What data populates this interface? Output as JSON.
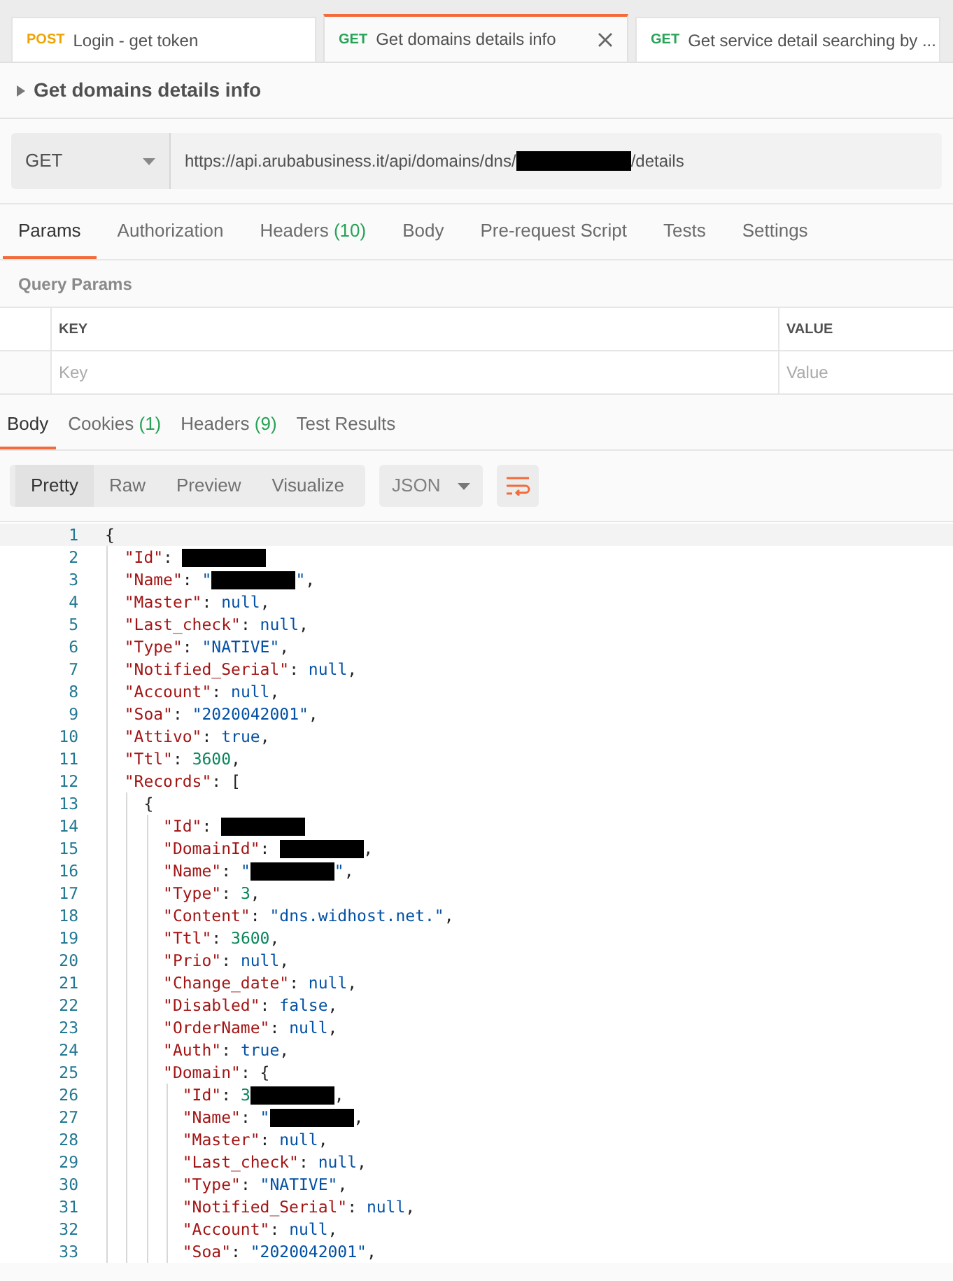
{
  "tabs": [
    {
      "method": "POST",
      "color": "#f0a300",
      "label": "Login - get token",
      "selected": false
    },
    {
      "method": "GET",
      "color": "#26a356",
      "label": "Get domains details info",
      "selected": true
    },
    {
      "method": "GET",
      "color": "#26a356",
      "label": "Get service detail searching by ...",
      "selected": false
    }
  ],
  "request_title": "Get domains details info",
  "request": {
    "method": "GET",
    "url_before": "https://api.arubabusiness.it/api/domains/dns/",
    "url_after": "/details"
  },
  "request_tabs": [
    {
      "label": "Params",
      "selected": true
    },
    {
      "label": "Authorization",
      "selected": false
    },
    {
      "label": "Headers",
      "count": "(10)",
      "selected": false
    },
    {
      "label": "Body",
      "selected": false
    },
    {
      "label": "Pre-request Script",
      "selected": false
    },
    {
      "label": "Tests",
      "selected": false
    },
    {
      "label": "Settings",
      "selected": false
    }
  ],
  "query_params": {
    "title": "Query Params",
    "columns": [
      "KEY",
      "VALUE"
    ],
    "placeholders": [
      "Key",
      "Value"
    ]
  },
  "response_tabs": [
    {
      "label": "Body",
      "selected": true
    },
    {
      "label": "Cookies",
      "count": "(1)",
      "selected": false
    },
    {
      "label": "Headers",
      "count": "(9)",
      "selected": false
    },
    {
      "label": "Test Results",
      "selected": false
    }
  ],
  "view_modes": [
    {
      "label": "Pretty",
      "selected": true
    },
    {
      "label": "Raw",
      "selected": false
    },
    {
      "label": "Preview",
      "selected": false
    },
    {
      "label": "Visualize",
      "selected": false
    }
  ],
  "format": "JSON",
  "code_lines": [
    {
      "number": "1",
      "tokens": [
        {
          "kind": "punct",
          "text": "{"
        }
      ]
    },
    {
      "number": "2",
      "tokens": [
        {
          "kind": "key",
          "text": "  \"Id\""
        },
        {
          "kind": "punct",
          "text": ": "
        },
        {
          "kind": "redacted"
        }
      ]
    },
    {
      "number": "3",
      "tokens": [
        {
          "kind": "key",
          "text": "  \"Name\""
        },
        {
          "kind": "punct",
          "text": ": "
        },
        {
          "kind": "string",
          "text": "\""
        },
        {
          "kind": "redacted"
        },
        {
          "kind": "string",
          "text": "\""
        },
        {
          "kind": "punct",
          "text": ","
        }
      ]
    },
    {
      "number": "4",
      "tokens": [
        {
          "kind": "key",
          "text": "  \"Master\""
        },
        {
          "kind": "punct",
          "text": ": "
        },
        {
          "kind": "literal",
          "text": "null"
        },
        {
          "kind": "punct",
          "text": ","
        }
      ]
    },
    {
      "number": "5",
      "tokens": [
        {
          "kind": "key",
          "text": "  \"Last_check\""
        },
        {
          "kind": "punct",
          "text": ": "
        },
        {
          "kind": "literal",
          "text": "null"
        },
        {
          "kind": "punct",
          "text": ","
        }
      ]
    },
    {
      "number": "6",
      "tokens": [
        {
          "kind": "key",
          "text": "  \"Type\""
        },
        {
          "kind": "punct",
          "text": ": "
        },
        {
          "kind": "string",
          "text": "\"NATIVE\""
        },
        {
          "kind": "punct",
          "text": ","
        }
      ]
    },
    {
      "number": "7",
      "tokens": [
        {
          "kind": "key",
          "text": "  \"Notified_Serial\""
        },
        {
          "kind": "punct",
          "text": ": "
        },
        {
          "kind": "literal",
          "text": "null"
        },
        {
          "kind": "punct",
          "text": ","
        }
      ]
    },
    {
      "number": "8",
      "tokens": [
        {
          "kind": "key",
          "text": "  \"Account\""
        },
        {
          "kind": "punct",
          "text": ": "
        },
        {
          "kind": "literal",
          "text": "null"
        },
        {
          "kind": "punct",
          "text": ","
        }
      ]
    },
    {
      "number": "9",
      "tokens": [
        {
          "kind": "key",
          "text": "  \"Soa\""
        },
        {
          "kind": "punct",
          "text": ": "
        },
        {
          "kind": "string",
          "text": "\"2020042001\""
        },
        {
          "kind": "punct",
          "text": ","
        }
      ]
    },
    {
      "number": "10",
      "tokens": [
        {
          "kind": "key",
          "text": "  \"Attivo\""
        },
        {
          "kind": "punct",
          "text": ": "
        },
        {
          "kind": "literal",
          "text": "true"
        },
        {
          "kind": "punct",
          "text": ","
        }
      ]
    },
    {
      "number": "11",
      "tokens": [
        {
          "kind": "key",
          "text": "  \"Ttl\""
        },
        {
          "kind": "punct",
          "text": ": "
        },
        {
          "kind": "number",
          "text": "3600"
        },
        {
          "kind": "punct",
          "text": ","
        }
      ]
    },
    {
      "number": "12",
      "tokens": [
        {
          "kind": "key",
          "text": "  \"Records\""
        },
        {
          "kind": "punct",
          "text": ": ["
        }
      ]
    },
    {
      "number": "13",
      "tokens": [
        {
          "kind": "punct",
          "text": "    {"
        }
      ]
    },
    {
      "number": "14",
      "tokens": [
        {
          "kind": "key",
          "text": "      \"Id\""
        },
        {
          "kind": "punct",
          "text": ": "
        },
        {
          "kind": "redacted"
        }
      ]
    },
    {
      "number": "15",
      "tokens": [
        {
          "kind": "key",
          "text": "      \"DomainId\""
        },
        {
          "kind": "punct",
          "text": ": "
        },
        {
          "kind": "redacted"
        },
        {
          "kind": "punct",
          "text": ","
        }
      ]
    },
    {
      "number": "16",
      "tokens": [
        {
          "kind": "key",
          "text": "      \"Name\""
        },
        {
          "kind": "punct",
          "text": ": "
        },
        {
          "kind": "string",
          "text": "\""
        },
        {
          "kind": "redacted"
        },
        {
          "kind": "string",
          "text": "\""
        },
        {
          "kind": "punct",
          "text": ","
        }
      ]
    },
    {
      "number": "17",
      "tokens": [
        {
          "kind": "key",
          "text": "      \"Type\""
        },
        {
          "kind": "punct",
          "text": ": "
        },
        {
          "kind": "number",
          "text": "3"
        },
        {
          "kind": "punct",
          "text": ","
        }
      ]
    },
    {
      "number": "18",
      "tokens": [
        {
          "kind": "key",
          "text": "      \"Content\""
        },
        {
          "kind": "punct",
          "text": ": "
        },
        {
          "kind": "string",
          "text": "\"dns.widhost.net.\""
        },
        {
          "kind": "punct",
          "text": ","
        }
      ]
    },
    {
      "number": "19",
      "tokens": [
        {
          "kind": "key",
          "text": "      \"Ttl\""
        },
        {
          "kind": "punct",
          "text": ": "
        },
        {
          "kind": "number",
          "text": "3600"
        },
        {
          "kind": "punct",
          "text": ","
        }
      ]
    },
    {
      "number": "20",
      "tokens": [
        {
          "kind": "key",
          "text": "      \"Prio\""
        },
        {
          "kind": "punct",
          "text": ": "
        },
        {
          "kind": "literal",
          "text": "null"
        },
        {
          "kind": "punct",
          "text": ","
        }
      ]
    },
    {
      "number": "21",
      "tokens": [
        {
          "kind": "key",
          "text": "      \"Change_date\""
        },
        {
          "kind": "punct",
          "text": ": "
        },
        {
          "kind": "literal",
          "text": "null"
        },
        {
          "kind": "punct",
          "text": ","
        }
      ]
    },
    {
      "number": "22",
      "tokens": [
        {
          "kind": "key",
          "text": "      \"Disabled\""
        },
        {
          "kind": "punct",
          "text": ": "
        },
        {
          "kind": "literal",
          "text": "false"
        },
        {
          "kind": "punct",
          "text": ","
        }
      ]
    },
    {
      "number": "23",
      "tokens": [
        {
          "kind": "key",
          "text": "      \"OrderName\""
        },
        {
          "kind": "punct",
          "text": ": "
        },
        {
          "kind": "literal",
          "text": "null"
        },
        {
          "kind": "punct",
          "text": ","
        }
      ]
    },
    {
      "number": "24",
      "tokens": [
        {
          "kind": "key",
          "text": "      \"Auth\""
        },
        {
          "kind": "punct",
          "text": ": "
        },
        {
          "kind": "literal",
          "text": "true"
        },
        {
          "kind": "punct",
          "text": ","
        }
      ]
    },
    {
      "number": "25",
      "tokens": [
        {
          "kind": "key",
          "text": "      \"Domain\""
        },
        {
          "kind": "punct",
          "text": ": {"
        }
      ]
    },
    {
      "number": "26",
      "tokens": [
        {
          "kind": "key",
          "text": "        \"Id\""
        },
        {
          "kind": "punct",
          "text": ": "
        },
        {
          "kind": "number",
          "text": "3"
        },
        {
          "kind": "redacted"
        },
        {
          "kind": "punct",
          "text": ","
        }
      ]
    },
    {
      "number": "27",
      "tokens": [
        {
          "kind": "key",
          "text": "        \"Name\""
        },
        {
          "kind": "punct",
          "text": ": "
        },
        {
          "kind": "string",
          "text": "\""
        },
        {
          "kind": "redacted"
        },
        {
          "kind": "punct",
          "text": ","
        }
      ]
    },
    {
      "number": "28",
      "tokens": [
        {
          "kind": "key",
          "text": "        \"Master\""
        },
        {
          "kind": "punct",
          "text": ": "
        },
        {
          "kind": "literal",
          "text": "null"
        },
        {
          "kind": "punct",
          "text": ","
        }
      ]
    },
    {
      "number": "29",
      "tokens": [
        {
          "kind": "key",
          "text": "        \"Last_check\""
        },
        {
          "kind": "punct",
          "text": ": "
        },
        {
          "kind": "literal",
          "text": "null"
        },
        {
          "kind": "punct",
          "text": ","
        }
      ]
    },
    {
      "number": "30",
      "tokens": [
        {
          "kind": "key",
          "text": "        \"Type\""
        },
        {
          "kind": "punct",
          "text": ": "
        },
        {
          "kind": "string",
          "text": "\"NATIVE\""
        },
        {
          "kind": "punct",
          "text": ","
        }
      ]
    },
    {
      "number": "31",
      "tokens": [
        {
          "kind": "key",
          "text": "        \"Notified_Serial\""
        },
        {
          "kind": "punct",
          "text": ": "
        },
        {
          "kind": "literal",
          "text": "null"
        },
        {
          "kind": "punct",
          "text": ","
        }
      ]
    },
    {
      "number": "32",
      "tokens": [
        {
          "kind": "key",
          "text": "        \"Account\""
        },
        {
          "kind": "punct",
          "text": ": "
        },
        {
          "kind": "literal",
          "text": "null"
        },
        {
          "kind": "punct",
          "text": ","
        }
      ]
    },
    {
      "number": "33",
      "tokens": [
        {
          "kind": "key",
          "text": "        \"Soa\""
        },
        {
          "kind": "punct",
          "text": ": "
        },
        {
          "kind": "string",
          "text": "\"2020042001\""
        },
        {
          "kind": "punct",
          "text": ","
        }
      ]
    }
  ]
}
